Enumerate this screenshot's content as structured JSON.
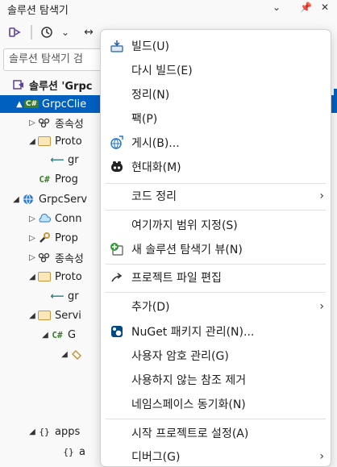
{
  "window": {
    "title": "솔루션 탐색기",
    "title_icons": [
      "chevron-down-icon",
      "pin-icon",
      "close-icon"
    ]
  },
  "toolbar": {
    "icons": [
      "switch-views-icon",
      "history-icon",
      "chevron-down-icon",
      "sync-icon",
      "chevron-up-icon",
      "copy-icon",
      "pending-changes-icon",
      "settings-icon",
      "preview-icon"
    ]
  },
  "search": {
    "placeholder": "솔루션 탐색기 검"
  },
  "tree": [
    {
      "label": "솔루션 'Grpc",
      "icon": "solution-icon",
      "arrow": "",
      "bold": true
    },
    {
      "label": "GrpcClie",
      "icon": "csharp-project-icon",
      "arrow": "▲",
      "selected": true
    },
    {
      "label": "종속성",
      "icon": "dependencies-icon",
      "arrow": "▷"
    },
    {
      "label": "Proto",
      "icon": "folder-icon",
      "arrow": "◢"
    },
    {
      "label": "gr",
      "icon": "proto-file-icon",
      "arrow": ""
    },
    {
      "label": "Prog",
      "icon": "csharp-file-icon",
      "arrow": ""
    },
    {
      "label": "GrpcServ",
      "icon": "web-project-icon",
      "arrow": "◢"
    },
    {
      "label": "Conn",
      "icon": "connected-services-icon",
      "arrow": "▷"
    },
    {
      "label": "Prop",
      "icon": "properties-icon",
      "arrow": "▷"
    },
    {
      "label": "종속성",
      "icon": "dependencies-icon",
      "arrow": "▷"
    },
    {
      "label": "Proto",
      "icon": "folder-icon",
      "arrow": "◢"
    },
    {
      "label": "gr",
      "icon": "proto-file-icon",
      "arrow": ""
    },
    {
      "label": "Servi",
      "icon": "folder-icon",
      "arrow": "◢"
    },
    {
      "label": "G",
      "icon": "csharp-file-icon",
      "arrow": "◢"
    },
    {
      "label": "",
      "icon": "class-icon",
      "arrow": "◢"
    },
    {
      "label": "apps",
      "icon": "json-file-icon",
      "arrow": "◢"
    },
    {
      "label": "a",
      "icon": "json-file-icon",
      "arrow": ""
    }
  ],
  "context_menu": {
    "items": [
      {
        "label": "빌드(U)",
        "icon": "build-icon",
        "submenu": false
      },
      {
        "label": "다시 빌드(E)",
        "icon": "",
        "submenu": false
      },
      {
        "label": "정리(N)",
        "icon": "",
        "submenu": false
      },
      {
        "label": "팩(P)",
        "icon": "",
        "submenu": false
      },
      {
        "label": "게시(B)...",
        "icon": "publish-icon",
        "submenu": false
      },
      {
        "label": "현대화(M)",
        "icon": "copilot-icon",
        "submenu": false
      },
      {
        "label": "코드 정리",
        "icon": "",
        "submenu": true
      },
      {
        "label": "여기까지 범위 지정(S)",
        "icon": "",
        "submenu": false
      },
      {
        "label": "새 솔루션 탐색기 뷰(N)",
        "icon": "new-view-icon",
        "submenu": false
      },
      {
        "label": "프로젝트 파일 편집",
        "icon": "edit-project-icon",
        "submenu": false
      },
      {
        "label": "추가(D)",
        "icon": "",
        "submenu": true
      },
      {
        "label": "NuGet 패키지 관리(N)...",
        "icon": "nuget-icon",
        "submenu": false
      },
      {
        "label": "사용자 암호 관리(G)",
        "icon": "",
        "submenu": false
      },
      {
        "label": "사용하지 않는 참조 제거",
        "icon": "",
        "submenu": false
      },
      {
        "label": "네임스페이스 동기화(N)",
        "icon": "",
        "submenu": false
      },
      {
        "label": "시작 프로젝트로 설정(A)",
        "icon": "",
        "submenu": false
      },
      {
        "label": "디버그(G)",
        "icon": "",
        "submenu": true
      }
    ]
  },
  "colors": {
    "selection": "#0060c0",
    "accent_green": "#3b7d2e",
    "folder": "#c8963c"
  }
}
